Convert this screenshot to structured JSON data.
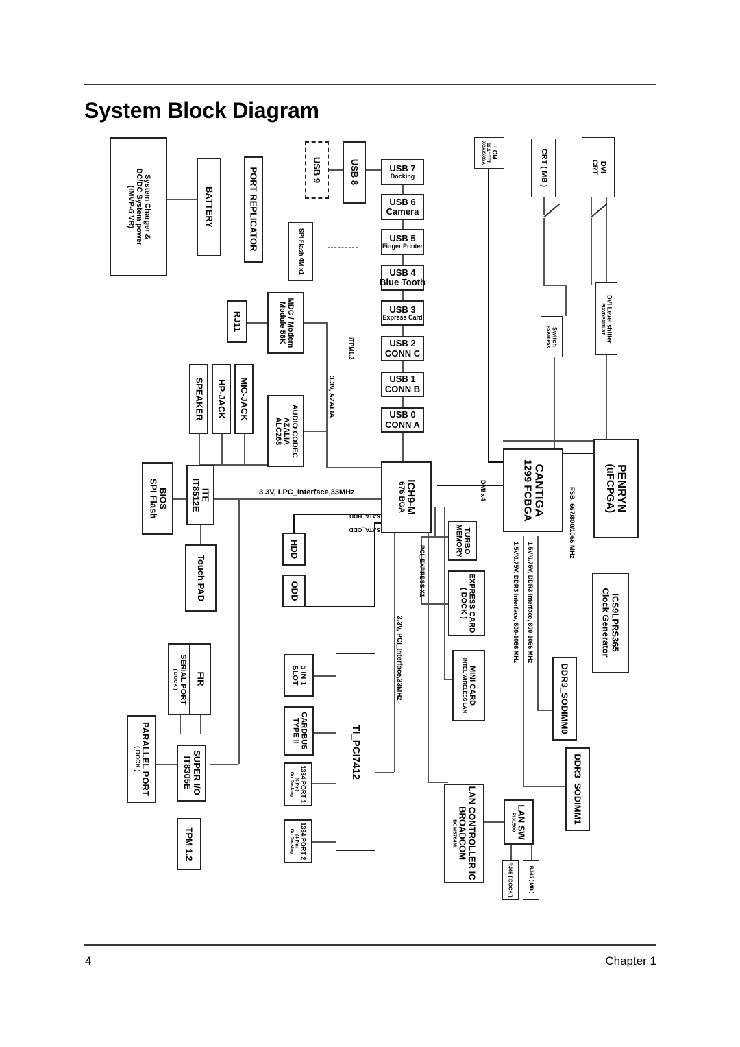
{
  "page": {
    "title": "System Block Diagram",
    "footer_page_number": "4",
    "footer_chapter": "Chapter 1"
  },
  "blocks": {
    "system_charger": {
      "line1": "System Charger &",
      "line2": "DC/DC System power",
      "line3": "(IMVP-6  VR)"
    },
    "battery": {
      "line1": "BATTERY"
    },
    "port_replicator": {
      "line1": "PORT REPLICATOR"
    },
    "usb9": {
      "line1": "USB 9"
    },
    "usb8": {
      "line1": "USB 8"
    },
    "usb7": {
      "line1": "USB 7",
      "line2": "Docking"
    },
    "usb6": {
      "line1": "USB 6",
      "line2": "Camera"
    },
    "usb5": {
      "line1": "USB 5",
      "line2": "Finger Printer"
    },
    "usb4": {
      "line1": "USB 4",
      "line2": "Blue Tooth"
    },
    "usb3": {
      "line1": "USB 3",
      "line2": "Express Card"
    },
    "usb2": {
      "line1": "USB 2",
      "line2": "CONN C"
    },
    "usb1": {
      "line1": "USB 1",
      "line2": "CONN B"
    },
    "usb0": {
      "line1": "USB 0",
      "line2": "CONN A"
    },
    "spi_flash_4m": {
      "line1": "SPI Flash 4M x1"
    },
    "rj11": {
      "line1": "RJ11"
    },
    "mdc_modem": {
      "line1": "MDC / Modem",
      "line2": "Module 56K"
    },
    "speaker": {
      "line1": "SPEAKER"
    },
    "hp_jack": {
      "line1": "HP-JACK"
    },
    "mic_jack": {
      "line1": "MIC-JACK"
    },
    "audio_codec": {
      "line1": "AUDIO CODEC",
      "line2": "AZALIA",
      "line3": "ALC268"
    },
    "bios_spi_flash": {
      "line1": "BIOS",
      "line2": "SPI Flash"
    },
    "ite": {
      "line1": "ITE",
      "line2": "IT8512E"
    },
    "touch_pad": {
      "line1": "Touch PAD"
    },
    "ich9m": {
      "line1": "ICH9-M",
      "line2": "676 BGA"
    },
    "hdd": {
      "line1": "HDD"
    },
    "odd": {
      "line1": "ODD"
    },
    "turbo_memory": {
      "line1": "TURBO",
      "line2": "MEMORY"
    },
    "express_card": {
      "line1": "EXPRESS CARD",
      "line2": "( DOCK )"
    },
    "mini_card": {
      "line1": "MINI CARD",
      "line2": "INTEL WIRELESS LAN"
    },
    "cantiga": {
      "line1": "CANTIGA",
      "line2": "1299 FCBGA"
    },
    "penryn": {
      "line1": "PENRYN",
      "line2": "(uFCPGA)"
    },
    "clock_generator": {
      "line1": "ICS9LPRS365",
      "line2": "Clock Generator"
    },
    "sodimm0": {
      "line1": "DDR3_SODIMM0"
    },
    "sodimm1": {
      "line1": "DDR3_SODIMM1"
    },
    "lcm": {
      "line1": "LCM",
      "line2": "12.1\" TFT",
      "line3": "XGA/SXGA"
    },
    "crt_mb": {
      "line1": "CRT ( MB )"
    },
    "dvi_crt": {
      "line1": "DVI",
      "line2": "CRT"
    },
    "switch": {
      "line1": "Switch",
      "line2": "FSA66P5X"
    },
    "dvi_level_shifter": {
      "line1": "DVI Level shifter",
      "line2": "PI3VDP411LST"
    },
    "serial_port": {
      "line1": "SERIAL PORT",
      "line2": "( DOCK )"
    },
    "fir": {
      "line1": "FIR"
    },
    "parallel_port": {
      "line1": "PARALLEL PORT",
      "line2": "( DOCK )"
    },
    "super_io": {
      "line1": "SUPER I/O",
      "line2": "IT8305E"
    },
    "tpm": {
      "line1": "TPM 1.2"
    },
    "slot_5in1": {
      "line1": "5 IN 1",
      "line2": "SLOT"
    },
    "cardbus": {
      "line1": "CARDBUS",
      "line2": "TYPE II"
    },
    "fw_port1": {
      "line1": "1394 PORT 1",
      "line2": "(6 Pin)",
      "line3": "On Docking"
    },
    "fw_port2": {
      "line1": "1394 PORT 2",
      "line2": "(4 Pin)",
      "line3": "On Docking"
    },
    "ti_pci7412": {
      "line1": "TI_PCI7412"
    },
    "lan_controller": {
      "line1": "LAN CONTROLLER IC",
      "line2": "BROADCOM",
      "line3": "BCM5764M"
    },
    "lan_sw": {
      "line1": "LAN SW",
      "line2": "PI3L500"
    },
    "rj45_dock": {
      "line1": "RJ45 ( DOCK )"
    },
    "rj45_mb": {
      "line1": "RJ45 ( MB )"
    }
  },
  "wire_labels": {
    "lpc": "3.3V, LPC_Interface,33MHz",
    "azalia": "3.3V, AZALIA",
    "itpm": "iTPM1.2",
    "sata_hdd": "SATA_HDD",
    "sata_odd": "SATA_ODD",
    "pci_express_x1": "PCI_EXPRESS X1",
    "pci_interface": "3.3V, PCI_Interface,33MHz",
    "dmi_x4": "DMI x4",
    "fsb": "FSB, 667/800/1066 MHz",
    "ddr3_a": "1.5V/0.75V, DDR3 Interface, 800-1066 MHz",
    "ddr3_b": "1.5V/0.75V, DDR3 Interface, 800-1066 MHz"
  },
  "colors": {
    "ink": "#000000",
    "box_border": "#222222",
    "wire": "#555555",
    "rule": "#3a3a3a",
    "page_bg": "#ffffff"
  }
}
